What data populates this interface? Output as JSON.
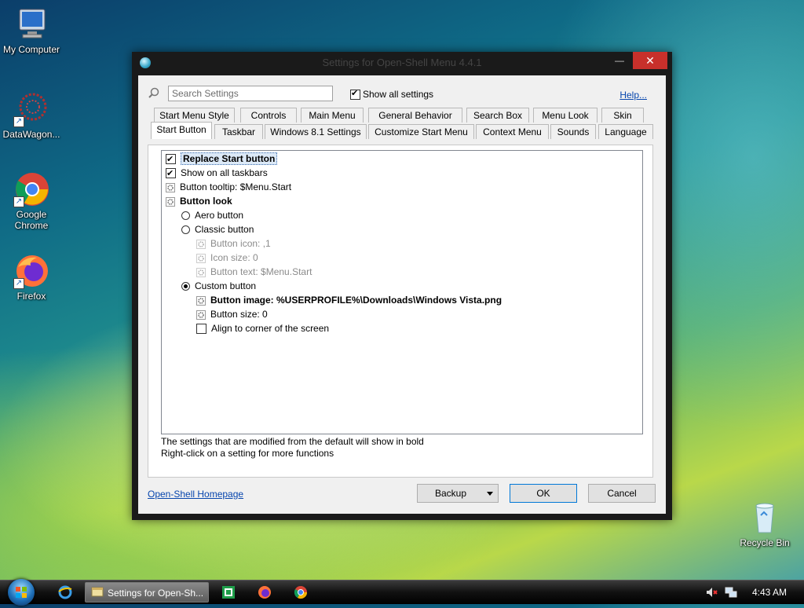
{
  "desktop": {
    "icons": [
      {
        "label": "My Computer"
      },
      {
        "label": "DataWagon..."
      },
      {
        "label": "Google Chrome"
      },
      {
        "label": "Firefox"
      },
      {
        "label": "Recycle Bin"
      }
    ]
  },
  "window": {
    "title": "Settings for Open-Shell Menu 4.4.1",
    "close_glyph": "✕",
    "minimize_glyph": "—"
  },
  "toolbar": {
    "search_placeholder": "Search Settings",
    "show_all_label": "Show all settings",
    "show_all_checked": true,
    "help_label": "Help..."
  },
  "tabs": {
    "row1": [
      "Start Menu Style",
      "Controls",
      "Main Menu",
      "General Behavior",
      "Search Box",
      "Menu Look",
      "Skin"
    ],
    "row2": [
      "Start Button",
      "Taskbar",
      "Windows 8.1 Settings",
      "Customize Start Menu",
      "Context Menu",
      "Sounds",
      "Language"
    ],
    "active": "Start Button"
  },
  "settings": [
    {
      "label": "Replace Start button"
    },
    {
      "label": "Show on all taskbars"
    },
    {
      "label": "Button tooltip: $Menu.Start"
    },
    {
      "label": "Button look"
    },
    {
      "label": "Aero button"
    },
    {
      "label": "Classic button"
    },
    {
      "label": "Button icon: ,1"
    },
    {
      "label": "Icon size: 0"
    },
    {
      "label": "Button text: $Menu.Start"
    },
    {
      "label": "Custom button"
    },
    {
      "label": "Button image: %USERPROFILE%\\Downloads\\Windows Vista.png"
    },
    {
      "label": "Button size: 0"
    },
    {
      "label": "Align to corner of the screen"
    }
  ],
  "footnotes": {
    "line1": "The settings that are modified from the default will show in bold",
    "line2": "Right-click on a setting for more functions"
  },
  "footer": {
    "homepage_label": "Open-Shell Homepage",
    "backup_label": "Backup",
    "ok_label": "OK",
    "cancel_label": "Cancel"
  },
  "taskbar": {
    "active_window_label": "Settings for Open-Sh...",
    "clock": "4:43 AM"
  }
}
